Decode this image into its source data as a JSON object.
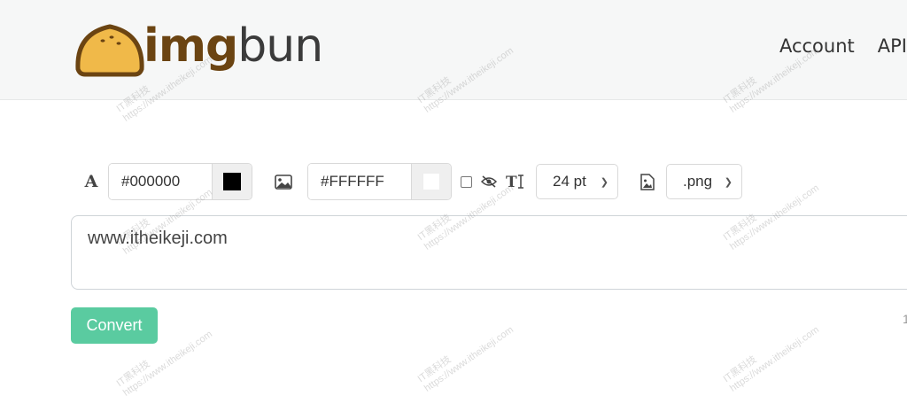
{
  "brand": {
    "name_part1": "img",
    "name_part2": "bun",
    "logo_color": "#f0b949",
    "logo_outline": "#6b4412"
  },
  "nav": {
    "items": [
      "Account",
      "API"
    ]
  },
  "toolbar": {
    "text_color_value": "#000000",
    "text_swatch": "#000000",
    "bg_color_value": "#FFFFFF",
    "bg_swatch": "#FFFFFF",
    "font_size": "24 pt",
    "format": ".png"
  },
  "editor": {
    "text": "www.itheikeji.com"
  },
  "actions": {
    "convert_label": "Convert",
    "accent": "#5acba0"
  },
  "watermark": {
    "line1": "IT黑科技",
    "line2": "https://www.itheikeji.com"
  }
}
